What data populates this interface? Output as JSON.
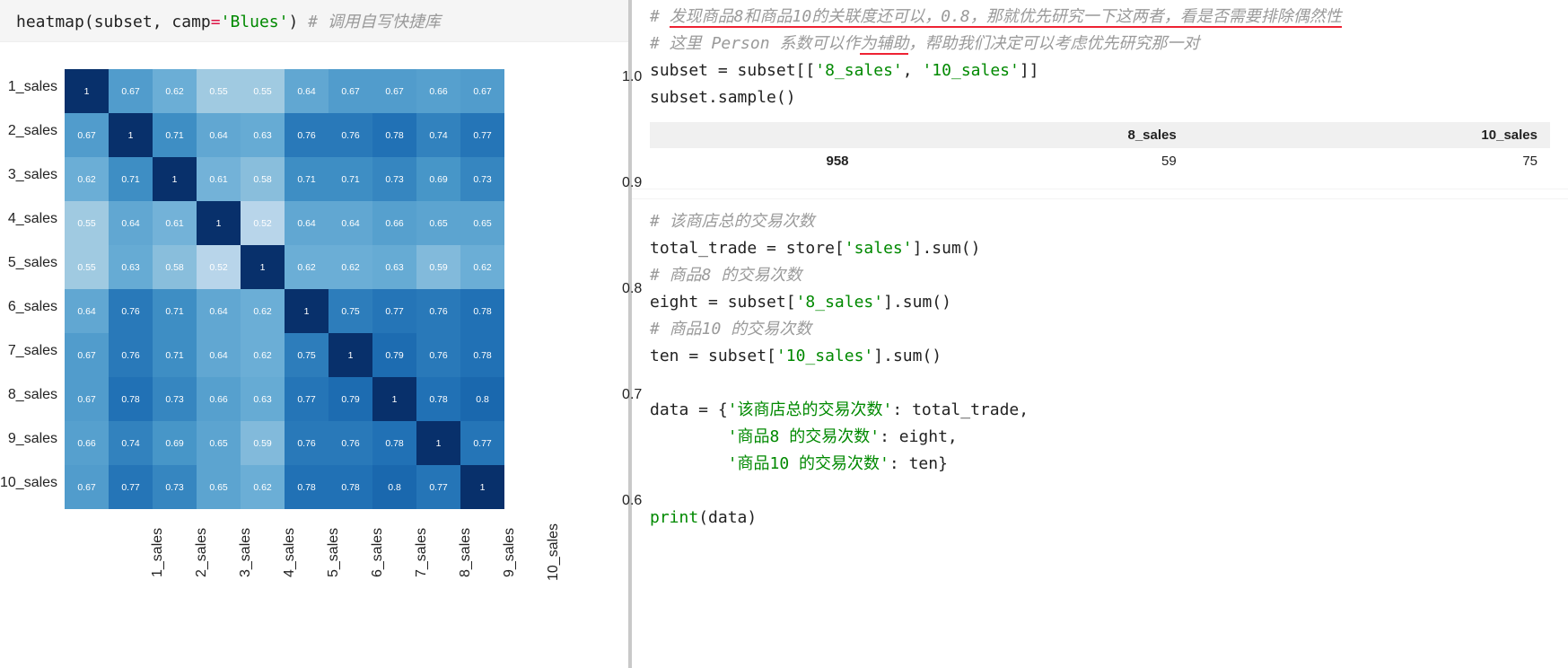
{
  "left_code": {
    "fn": "heatmap",
    "arg1": "subset",
    "kw": "camp",
    "val": "'Blues'",
    "comment": "# 调用自写快捷库"
  },
  "chart_data": {
    "type": "heatmap",
    "xlabels": [
      "1_sales",
      "2_sales",
      "3_sales",
      "4_sales",
      "5_sales",
      "6_sales",
      "7_sales",
      "8_sales",
      "9_sales",
      "10_sales"
    ],
    "ylabels": [
      "1_sales",
      "2_sales",
      "3_sales",
      "4_sales",
      "5_sales",
      "6_sales",
      "7_sales",
      "8_sales",
      "9_sales",
      "10_sales"
    ],
    "values": [
      [
        1,
        0.67,
        0.62,
        0.55,
        0.55,
        0.64,
        0.67,
        0.67,
        0.66,
        0.67
      ],
      [
        0.67,
        1,
        0.71,
        0.64,
        0.63,
        0.76,
        0.76,
        0.78,
        0.74,
        0.77
      ],
      [
        0.62,
        0.71,
        1,
        0.61,
        0.58,
        0.71,
        0.71,
        0.73,
        0.69,
        0.73
      ],
      [
        0.55,
        0.64,
        0.61,
        1,
        0.52,
        0.64,
        0.64,
        0.66,
        0.65,
        0.65
      ],
      [
        0.55,
        0.63,
        0.58,
        0.52,
        1,
        0.62,
        0.62,
        0.63,
        0.59,
        0.62
      ],
      [
        0.64,
        0.76,
        0.71,
        0.64,
        0.62,
        1,
        0.75,
        0.77,
        0.76,
        0.78
      ],
      [
        0.67,
        0.76,
        0.71,
        0.64,
        0.62,
        0.75,
        1,
        0.79,
        0.76,
        0.78
      ],
      [
        0.67,
        0.78,
        0.73,
        0.66,
        0.63,
        0.77,
        0.79,
        1,
        0.78,
        0.8
      ],
      [
        0.66,
        0.74,
        0.69,
        0.65,
        0.59,
        0.76,
        0.76,
        0.78,
        1,
        0.77
      ],
      [
        0.67,
        0.77,
        0.73,
        0.65,
        0.62,
        0.78,
        0.78,
        0.8,
        0.77,
        1
      ]
    ],
    "colorbar_ticks": [
      "1.0",
      "0.9",
      "0.8",
      "0.7",
      "0.6"
    ],
    "cmap": "Blues"
  },
  "right": {
    "c1_a": "# ",
    "c1_b": "发现商品8和商品10的关联度还可以，0.8，那就优先研究一下这两者，看是否需要排除偶然性",
    "c2_a": "# 这里 Person 系数可以作",
    "c2_b": "为辅助",
    "c2_c": "，帮助我们决定可以考虑优先研究那一对",
    "l3_a": "subset = subset[[",
    "l3_b": "'8_sales'",
    "l3_c": ", ",
    "l3_d": "'10_sales'",
    "l3_e": "]]",
    "l4": "subset.sample()",
    "table": {
      "cols": [
        "8_sales",
        "10_sales"
      ],
      "idx": "958",
      "v1": "59",
      "v2": "75"
    },
    "c5": "# 该商店总的交易次数",
    "l6_a": "total_trade = store[",
    "l6_b": "'sales'",
    "l6_c": "].sum()",
    "c7": "# 商品8 的交易次数",
    "l8_a": "eight = subset[",
    "l8_b": "'8_sales'",
    "l8_c": "].sum()",
    "c9": "# 商品10 的交易次数",
    "l10_a": "ten = subset[",
    "l10_b": "'10_sales'",
    "l10_c": "].sum()",
    "blank": "",
    "l12_a": "data = {",
    "l12_b": "'该商店总的交易次数'",
    "l12_c": ": total_trade,",
    "l13_a": "        ",
    "l13_b": "'商品8 的交易次数'",
    "l13_c": ": eight,",
    "l14_a": "        ",
    "l14_b": "'商品10 的交易次数'",
    "l14_c": ": ten}",
    "l16_a": "print",
    "l16_b": "(data)"
  }
}
